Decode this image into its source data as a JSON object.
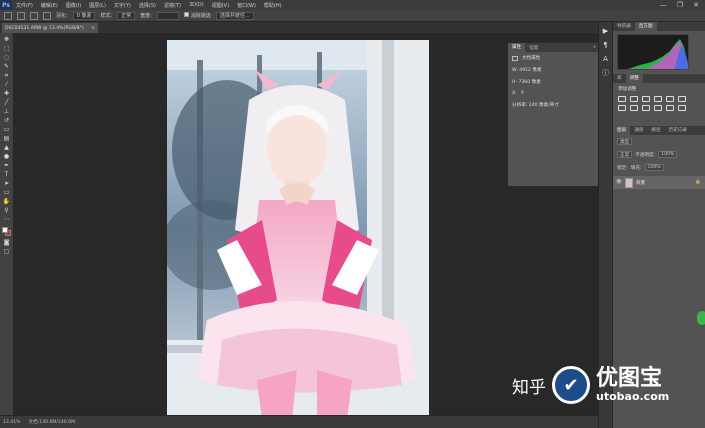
{
  "app": {
    "logo": "Ps",
    "menu": [
      "文件(F)",
      "编辑(E)",
      "图像(I)",
      "图层(L)",
      "文字(Y)",
      "选择(S)",
      "滤镜(T)",
      "3D(D)",
      "视图(V)",
      "窗口(W)",
      "帮助(H)"
    ],
    "window_controls": [
      "—",
      "❐",
      "✕"
    ]
  },
  "options": {
    "feather_label": "羽化:",
    "feather_value": "0 像素",
    "style_label": "样式:",
    "style_value": "正常",
    "width_label": "宽度:",
    "antialias_label": "消除锯齿",
    "refine_label": "选择并遮住..."
  },
  "document": {
    "tab_title": "DSC04531.ARW @ 13.4%(RGB/8*)",
    "tab_close": "×"
  },
  "status": {
    "zoom": "13.41%",
    "doc_size": "文档:140.6M/140.6M"
  },
  "properties_panel": {
    "tabs": [
      "属性",
      "信息"
    ],
    "close": "»",
    "doc_label": "文档属性",
    "w_label": "W: 4912 像素",
    "h_label": "H: 7360 像素",
    "x_label": "X:",
    "y_label": "Y:",
    "resolution": "分辨率: 240 像素/英寸"
  },
  "right_panels": {
    "histogram_tabs": [
      "导航器",
      "直方图"
    ],
    "adjustment_tabs": [
      "库",
      "调整"
    ],
    "adjustment_title": "添加调整",
    "layer_tabs": [
      "图层",
      "通道",
      "路径",
      "历史记录"
    ],
    "kind_label": "类型",
    "blend_mode": "正常",
    "opacity_label": "不透明度:",
    "opacity_value": "100%",
    "lock_label": "锁定:",
    "fill_label": "填充:",
    "fill_value": "100%",
    "layer_name": "背景",
    "lock_icon": "🔒"
  },
  "watermark": {
    "zhihu": "知乎",
    "brand": "优图宝",
    "url": "utobao.com",
    "bird": "✔"
  },
  "colors": {
    "accent": "#1c4c8c",
    "foreground": "#ffffff",
    "background": "#c82c2c"
  }
}
